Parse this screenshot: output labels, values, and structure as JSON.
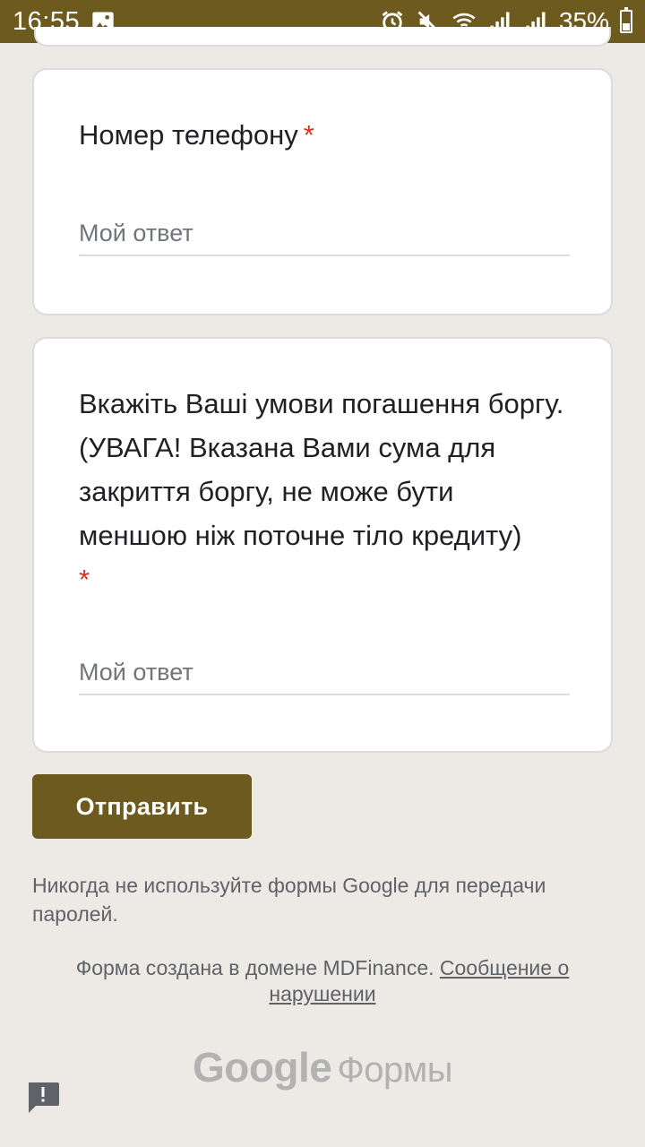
{
  "status_bar": {
    "time": "16:55",
    "battery_percent": "35%",
    "icons": [
      "image-icon",
      "alarm-icon",
      "mute-icon",
      "wifi-icon",
      "signal-icon",
      "signal-icon",
      "battery-icon"
    ]
  },
  "form": {
    "questions": [
      {
        "label": "Номер телефону",
        "required_mark": "*",
        "placeholder": "Мой ответ"
      },
      {
        "label": "Вкажіть Ваші умови погашення боргу. (УВАГА! Вказана Вами сума для закриття боргу, не може бути меншою ніж поточне тіло кредиту)",
        "required_mark": "*",
        "placeholder": "Мой ответ"
      }
    ],
    "submit_label": "Отправить"
  },
  "footer": {
    "warning": "Никогда не используйте формы Google для передачи паролей.",
    "domain_note": "Форма создана в домене MDFinance.",
    "report_link": "Сообщение о нарушении",
    "brand_google": "Google",
    "brand_forms": "Формы"
  },
  "colors": {
    "accent": "#6d5a1f",
    "background": "#edeae6",
    "required": "#d93025"
  }
}
